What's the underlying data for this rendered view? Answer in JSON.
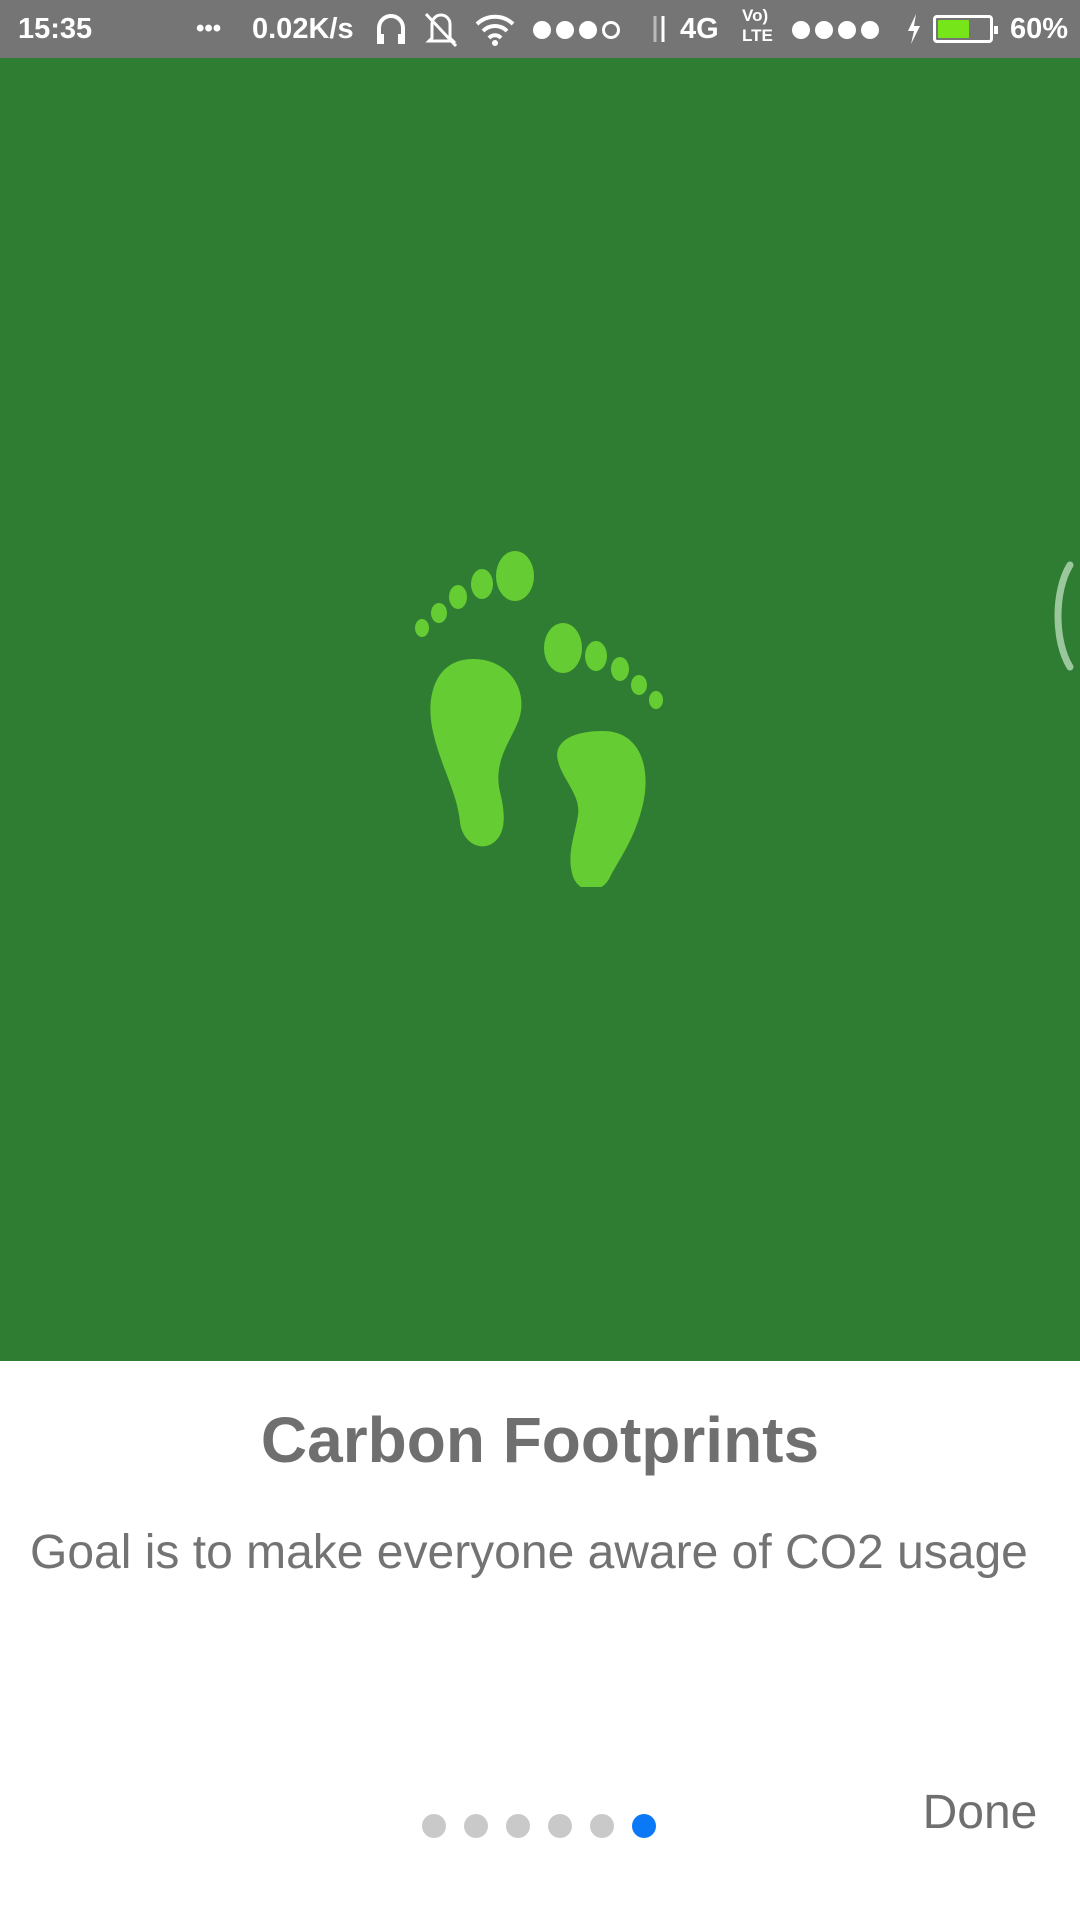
{
  "status_bar": {
    "time": "15:35",
    "more": "•••",
    "net_speed": "0.02K/s",
    "network_type": "4G",
    "volte_top": "Vo)",
    "volte_bottom": "LTE",
    "battery_level": 0.6,
    "battery_percent": "60%",
    "icons": [
      "headphones-icon",
      "vibrate-off-icon",
      "wifi-icon",
      "signal-dots-icon",
      "data-arrows-icon",
      "volte-icon",
      "signal-dots-icon",
      "charging-icon",
      "battery-icon"
    ]
  },
  "hero": {
    "background_color": "#2e7d32",
    "icon": "footprints-icon",
    "icon_color": "#66cc33"
  },
  "slide": {
    "title": "Carbon Footprints",
    "description": "Goal is to make everyone aware of CO2 usage"
  },
  "pager": {
    "count": 6,
    "active_index": 5,
    "active_color": "#0b79f5",
    "inactive_color": "#c9c9c9"
  },
  "done_label": "Done"
}
